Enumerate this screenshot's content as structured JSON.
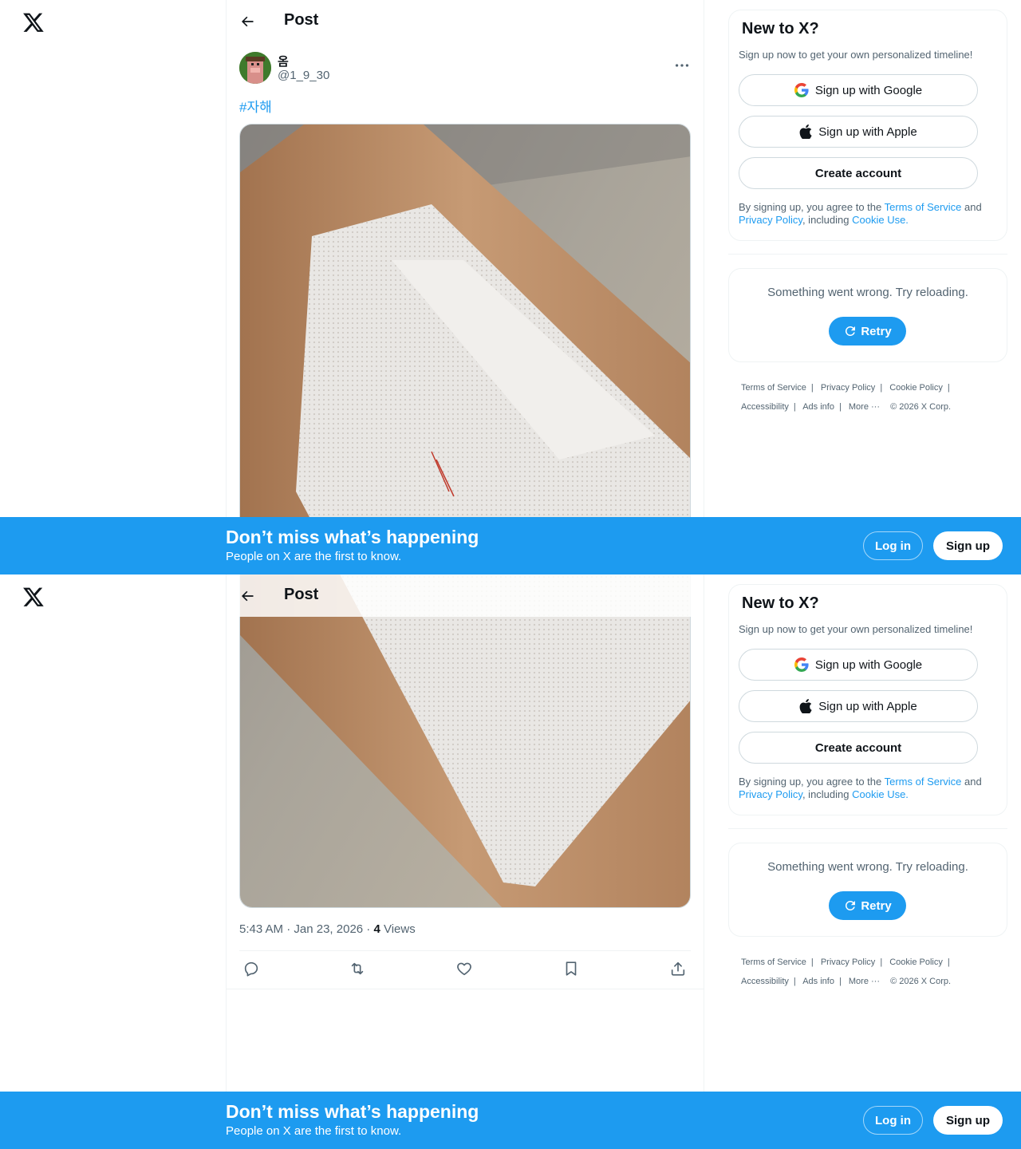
{
  "header": {
    "title": "Post"
  },
  "post": {
    "display_name": "옴",
    "handle": "@1_9_30",
    "hashtag": "#자해",
    "time": "5:43 AM",
    "separator": " · ",
    "date": "Jan 23, 2026",
    "views_count": "4",
    "views_label": " Views"
  },
  "signup_card": {
    "title": "New to X?",
    "subtitle": "Sign up now to get your own personalized timeline!",
    "google_label": "Sign up with Google",
    "apple_label": "Sign up with Apple",
    "create_label": "Create account",
    "legal_prefix": "By signing up, you agree to the ",
    "terms_link": "Terms of Service",
    "legal_and": " and ",
    "privacy_link": "Privacy Policy",
    "legal_including": ", including ",
    "cookie_link": "Cookie Use."
  },
  "error_card": {
    "message": "Something went wrong. Try reloading.",
    "retry_label": "Retry"
  },
  "footer": {
    "terms": "Terms of Service",
    "privacy": "Privacy Policy",
    "cookie": "Cookie Policy",
    "accessibility": "Accessibility",
    "ads_info": "Ads info",
    "more": "More ···",
    "copyright": "© 2026 X Corp."
  },
  "banner": {
    "title": "Don’t miss what’s happening",
    "subtitle": "People on X are the first to know.",
    "login_label": "Log in",
    "signup_label": "Sign up"
  },
  "colors": {
    "accent": "#1d9bf0",
    "text_primary": "#0f1419",
    "text_secondary": "#536471",
    "border": "#eff3f4"
  },
  "icons": [
    "x-logo-icon",
    "back-arrow-icon",
    "more-icon",
    "google-icon",
    "apple-icon",
    "retry-icon",
    "reply-icon",
    "repost-icon",
    "like-icon",
    "bookmark-icon",
    "share-icon"
  ]
}
